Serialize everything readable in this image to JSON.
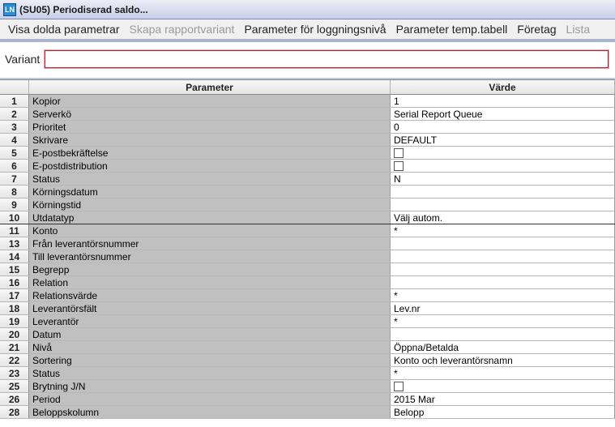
{
  "window": {
    "title": "(SU05) Periodiserad saldo..."
  },
  "toolbar": {
    "items": [
      {
        "label": "Visa dolda parametrar",
        "disabled": false
      },
      {
        "label": "Skapa rapportvariant",
        "disabled": true
      },
      {
        "label": "Parameter för loggningsnivå",
        "disabled": false
      },
      {
        "label": "Parameter temp.tabell",
        "disabled": false
      },
      {
        "label": "Företag",
        "disabled": false
      },
      {
        "label": "Lista",
        "disabled": true
      }
    ]
  },
  "variant": {
    "label": "Variant",
    "value": ""
  },
  "grid": {
    "headers": {
      "param": "Parameter",
      "value": "Värde"
    },
    "rows": [
      {
        "n": "1",
        "param": "Kopior",
        "value": "1",
        "type": "text"
      },
      {
        "n": "2",
        "param": "Serverkö",
        "value": "Serial Report Queue",
        "type": "text"
      },
      {
        "n": "3",
        "param": "Prioritet",
        "value": "0",
        "type": "text"
      },
      {
        "n": "4",
        "param": "Skrivare",
        "value": "DEFAULT",
        "type": "text"
      },
      {
        "n": "5",
        "param": "E-postbekräftelse",
        "value": "",
        "type": "checkbox"
      },
      {
        "n": "6",
        "param": "E-postdistribution",
        "value": "",
        "type": "checkbox"
      },
      {
        "n": "7",
        "param": "Status",
        "value": "N",
        "type": "text"
      },
      {
        "n": "8",
        "param": "Körningsdatum",
        "value": "",
        "type": "text"
      },
      {
        "n": "9",
        "param": "Körningstid",
        "value": "",
        "type": "text"
      },
      {
        "n": "10",
        "param": "Utdatatyp",
        "value": "Välj autom.",
        "type": "text",
        "sep": true
      },
      {
        "n": "11",
        "param": "Konto",
        "value": "*",
        "type": "text"
      },
      {
        "n": "13",
        "param": "Från leverantörsnummer",
        "value": "",
        "type": "text"
      },
      {
        "n": "14",
        "param": "Till leverantörsnummer",
        "value": "",
        "type": "text"
      },
      {
        "n": "15",
        "param": "Begrepp",
        "value": "",
        "type": "text"
      },
      {
        "n": "16",
        "param": "Relation",
        "value": "",
        "type": "text"
      },
      {
        "n": "17",
        "param": "Relationsvärde",
        "value": "*",
        "type": "text"
      },
      {
        "n": "18",
        "param": "Leverantörsfält",
        "value": "Lev.nr",
        "type": "text"
      },
      {
        "n": "19",
        "param": "Leverantör",
        "value": "*",
        "type": "text"
      },
      {
        "n": "20",
        "param": "Datum",
        "value": "",
        "type": "text"
      },
      {
        "n": "21",
        "param": "Nivå",
        "value": "Öppna/Betalda",
        "type": "text"
      },
      {
        "n": "22",
        "param": "Sortering",
        "value": "Konto och leverantörsnamn",
        "type": "text"
      },
      {
        "n": "23",
        "param": "Status",
        "value": "*",
        "type": "text"
      },
      {
        "n": "25",
        "param": "Brytning J/N",
        "value": "",
        "type": "checkbox"
      },
      {
        "n": "26",
        "param": "Period",
        "value": "2015 Mar",
        "type": "text"
      },
      {
        "n": "28",
        "param": "Beloppskolumn",
        "value": "Belopp",
        "type": "text"
      }
    ]
  }
}
